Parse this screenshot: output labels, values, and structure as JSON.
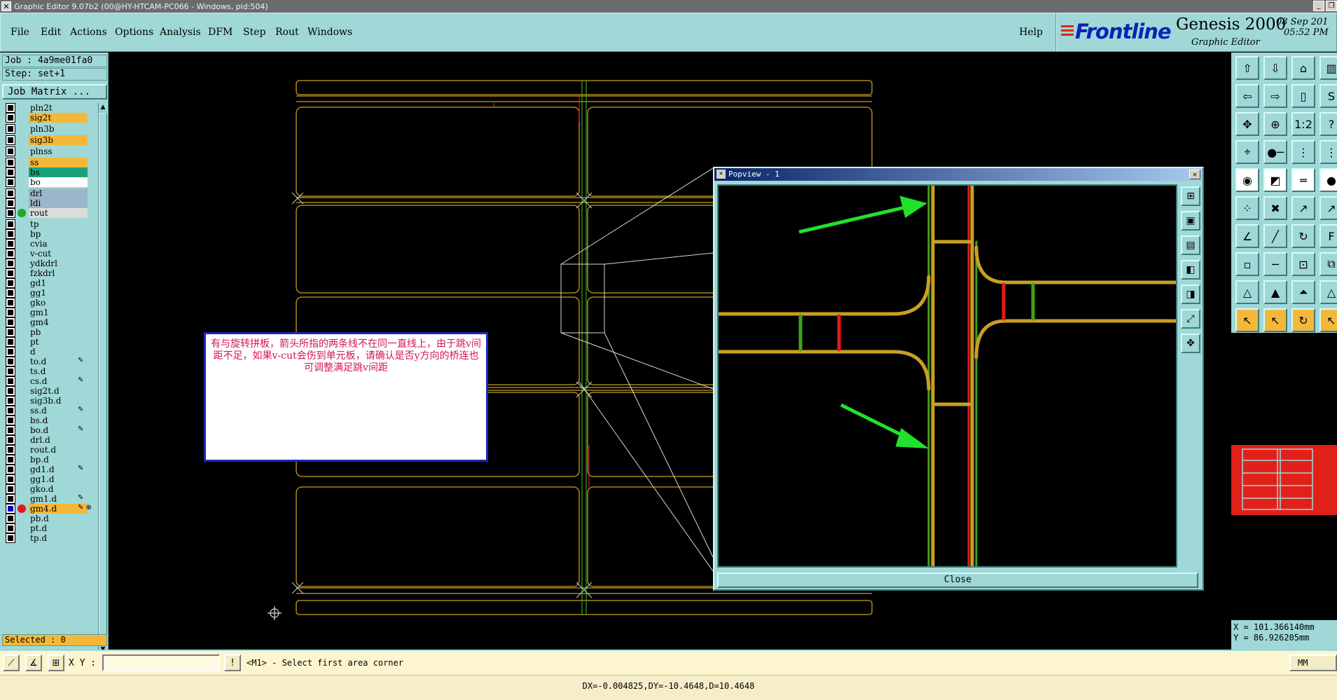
{
  "window": {
    "title": "Graphic Editor 9.07b2 (00@HY-HTCAM-PC066 - Windows, pid:504)"
  },
  "menu": {
    "items": [
      "File",
      "Edit",
      "Actions",
      "Options",
      "Analysis",
      "DFM",
      "Step",
      "Rout",
      "Windows"
    ],
    "help": "Help"
  },
  "brand": {
    "logo": "Frontline",
    "product": "Genesis 2000",
    "subtitle": "Graphic Editor",
    "date": "08 Sep 201",
    "time": "05:52 PM"
  },
  "job": {
    "job_line": "Job : 4a9me01fa0",
    "step_line": "Step: set+1",
    "matrix_button": "Job Matrix ..."
  },
  "layers": [
    {
      "name": "pln2t",
      "color": "#9fd8d6",
      "selected": false,
      "dot": "",
      "edit": ""
    },
    {
      "name": "sig2t",
      "color": "#f3b83a",
      "selected": false,
      "dot": "",
      "edit": ""
    },
    {
      "name": "pln3b",
      "color": "#9fd8d6",
      "selected": false,
      "dot": "",
      "edit": ""
    },
    {
      "name": "sig3b",
      "color": "#f3b83a",
      "selected": false,
      "dot": "",
      "edit": ""
    },
    {
      "name": "plnss",
      "color": "#9fd8d6",
      "selected": false,
      "dot": "",
      "edit": ""
    },
    {
      "name": "ss",
      "color": "#f3b83a",
      "selected": false,
      "dot": "",
      "edit": ""
    },
    {
      "name": "bs",
      "color": "#1aa37a",
      "selected": false,
      "dot": "",
      "edit": ""
    },
    {
      "name": "bo",
      "color": "#ffffff",
      "selected": false,
      "dot": "",
      "edit": ""
    },
    {
      "name": "drl",
      "color": "#9bb6c8",
      "selected": false,
      "dot": "",
      "edit": ""
    },
    {
      "name": "ldi",
      "color": "#9bb6c8",
      "selected": false,
      "dot": "",
      "edit": ""
    },
    {
      "name": "rout",
      "color": "#dcdcdc",
      "selected": false,
      "dot": "#21a52a",
      "edit": ""
    },
    {
      "name": "tp",
      "color": "#9fd8d6",
      "selected": false,
      "dot": "",
      "edit": ""
    },
    {
      "name": "bp",
      "color": "#9fd8d6",
      "selected": false,
      "dot": "",
      "edit": ""
    },
    {
      "name": "cvia",
      "color": "#9fd8d6",
      "selected": false,
      "dot": "",
      "edit": ""
    },
    {
      "name": "v-cut",
      "color": "#9fd8d6",
      "selected": false,
      "dot": "",
      "edit": ""
    },
    {
      "name": "ydkdrl",
      "color": "#9fd8d6",
      "selected": false,
      "dot": "",
      "edit": ""
    },
    {
      "name": "fzkdrl",
      "color": "#9fd8d6",
      "selected": false,
      "dot": "",
      "edit": ""
    },
    {
      "name": "gd1",
      "color": "#9fd8d6",
      "selected": false,
      "dot": "",
      "edit": ""
    },
    {
      "name": "gg1",
      "color": "#9fd8d6",
      "selected": false,
      "dot": "",
      "edit": ""
    },
    {
      "name": "gko",
      "color": "#9fd8d6",
      "selected": false,
      "dot": "",
      "edit": ""
    },
    {
      "name": "gm1",
      "color": "#9fd8d6",
      "selected": false,
      "dot": "",
      "edit": ""
    },
    {
      "name": "gm4",
      "color": "#9fd8d6",
      "selected": false,
      "dot": "",
      "edit": ""
    },
    {
      "name": "pb",
      "color": "#9fd8d6",
      "selected": false,
      "dot": "",
      "edit": ""
    },
    {
      "name": "pt",
      "color": "#9fd8d6",
      "selected": false,
      "dot": "",
      "edit": ""
    },
    {
      "name": "d",
      "color": "#9fd8d6",
      "selected": false,
      "dot": "",
      "edit": ""
    },
    {
      "name": "to.d",
      "color": "#9fd8d6",
      "selected": false,
      "dot": "",
      "edit": "✎"
    },
    {
      "name": "ts.d",
      "color": "#9fd8d6",
      "selected": false,
      "dot": "",
      "edit": ""
    },
    {
      "name": "cs.d",
      "color": "#9fd8d6",
      "selected": false,
      "dot": "",
      "edit": "✎"
    },
    {
      "name": "sig2t.d",
      "color": "#9fd8d6",
      "selected": false,
      "dot": "",
      "edit": ""
    },
    {
      "name": "sig3b.d",
      "color": "#9fd8d6",
      "selected": false,
      "dot": "",
      "edit": ""
    },
    {
      "name": "ss.d",
      "color": "#9fd8d6",
      "selected": false,
      "dot": "",
      "edit": "✎"
    },
    {
      "name": "bs.d",
      "color": "#9fd8d6",
      "selected": false,
      "dot": "",
      "edit": ""
    },
    {
      "name": "bo.d",
      "color": "#9fd8d6",
      "selected": false,
      "dot": "",
      "edit": "✎"
    },
    {
      "name": "drl.d",
      "color": "#9fd8d6",
      "selected": false,
      "dot": "",
      "edit": ""
    },
    {
      "name": "rout.d",
      "color": "#9fd8d6",
      "selected": false,
      "dot": "",
      "edit": ""
    },
    {
      "name": "bp.d",
      "color": "#9fd8d6",
      "selected": false,
      "dot": "",
      "edit": ""
    },
    {
      "name": "gd1.d",
      "color": "#9fd8d6",
      "selected": false,
      "dot": "",
      "edit": "✎"
    },
    {
      "name": "gg1.d",
      "color": "#9fd8d6",
      "selected": false,
      "dot": "",
      "edit": ""
    },
    {
      "name": "gko.d",
      "color": "#9fd8d6",
      "selected": false,
      "dot": "",
      "edit": ""
    },
    {
      "name": "gm1.d",
      "color": "#9fd8d6",
      "selected": false,
      "dot": "",
      "edit": "✎"
    },
    {
      "name": "gm4.d",
      "color": "#f3b83a",
      "selected": true,
      "dot": "#e01b1b",
      "edit": "✎ ⊕"
    },
    {
      "name": "pb.d",
      "color": "#9fd8d6",
      "selected": false,
      "dot": "",
      "edit": ""
    },
    {
      "name": "pt.d",
      "color": "#9fd8d6",
      "selected": false,
      "dot": "",
      "edit": ""
    },
    {
      "name": "tp.d",
      "color": "#9fd8d6",
      "selected": false,
      "dot": "",
      "edit": ""
    }
  ],
  "selected_count": "Selected : 0",
  "note": {
    "text": "有与旋转拼板，箭头所指的两条线不在同一直线上，由于跳v间距不足，如果v-cut会伤到单元板，请确认是否y方向的桥连也可调整满足跳v间距"
  },
  "popview": {
    "title": "Popview - 1",
    "close_label": "Close",
    "tool_icons": [
      "zoom-fit-icon",
      "zoom-in-icon",
      "zoom-out-icon",
      "pan-left-icon",
      "pan-right-icon",
      "zoom-area-icon",
      "home-icon"
    ]
  },
  "coords": {
    "x": "X = 101.366140mm",
    "y": "Y = 86.926205mm"
  },
  "command": {
    "xy_label": "X Y :",
    "xy_value": "",
    "prompt": "<M1> - Select first area corner",
    "units": "MM"
  },
  "status": {
    "text": "DX=-0.004825,DY=-10.4648,D=10.4648"
  },
  "colors": {
    "panel": "#9fd8d6",
    "highlight": "#f3b83a",
    "outline_layer": "#c8a021",
    "trace_green": "#3fa21a",
    "trace_red": "#e01b1b",
    "arrow": "#22e12c",
    "note_text": "#d4145a"
  }
}
